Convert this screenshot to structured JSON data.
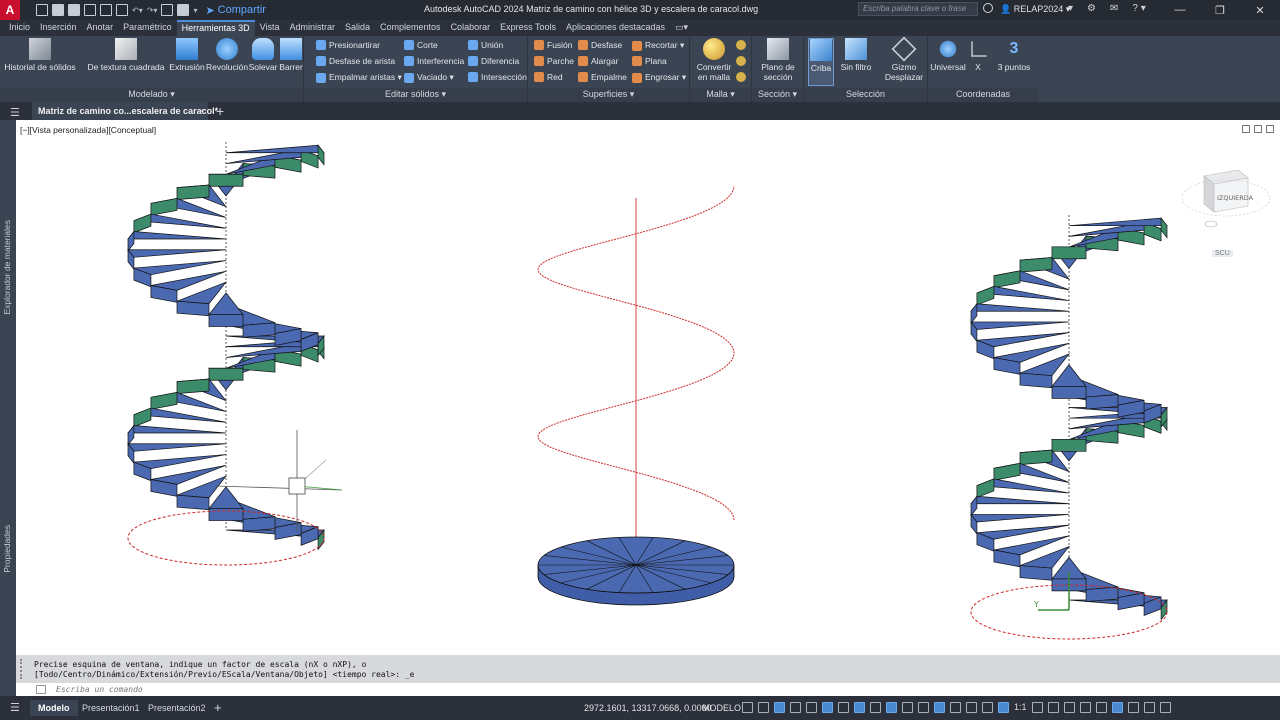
{
  "app": {
    "logo": "A",
    "title": "Autodesk AutoCAD 2024   Matriz de camino con hélice 3D y escalera de caracol.dwg",
    "share": "Compartir",
    "search_placeholder": "Escriba palabra clave o frase",
    "user": "RELAP2024"
  },
  "tabs": [
    "Inicio",
    "Inserción",
    "Anotar",
    "Paramétrico",
    "Herramientas 3D",
    "Vista",
    "Administrar",
    "Salida",
    "Complementos",
    "Colaborar",
    "Express Tools",
    "Aplicaciones destacadas"
  ],
  "active_tab": "Herramientas 3D",
  "ribbon": {
    "modelado": {
      "label": "Modelado ▾",
      "historial": "Historial de sólidos",
      "textura": "De textura cuadrada",
      "extrusion": "Extrusión",
      "revolucion": "Revolución",
      "solevar": "Solevar",
      "barrer": "Barrer"
    },
    "editar": {
      "label": "Editar sólidos ▾",
      "items": [
        "Presionartirar",
        "Desfase de arista",
        "Empalmar aristas ▾",
        "Corte",
        "Interferencia",
        "Vaciado ▾",
        "Unión",
        "Diferencia",
        "Intersección"
      ]
    },
    "superficies": {
      "label": "Superficies ▾",
      "items": [
        "Fusión",
        "Parche",
        "Red",
        "Desfase",
        "Alargar",
        "Empalme",
        "Recortar ▾",
        "Plana",
        "Engrosar ▾"
      ]
    },
    "malla": {
      "label": "Malla ▾",
      "convertir": "Convertir en malla"
    },
    "seccion": {
      "label": "Sección ▾",
      "plano": "Plano de sección"
    },
    "seleccion": {
      "label": "Selección",
      "criba": "Criba",
      "sinfiltro": "Sin filtro",
      "gizmo": "Gizmo Desplazar"
    },
    "coordenadas": {
      "label": "Coordenadas",
      "universal": "Universal",
      "x": "X",
      "tres": "3 puntos"
    }
  },
  "filetab": {
    "name": "Matriz de camino co...escalera de caracol*",
    "close": "×",
    "plus": "+"
  },
  "palettes": {
    "materiales": "Explorador de materiales",
    "propiedades": "Propiedades"
  },
  "viewport": {
    "label": "[−][Vista personalizada][Conceptual]",
    "viewcube": "IZQUIERDA",
    "ucs": "SCU"
  },
  "command": {
    "line1": "Precise esquina de ventana, indique un factor de escala (nX o nXP), o",
    "line2": "[Todo/Centro/Dinámico/Extensión/Previo/EScala/Ventana/Objeto] <tiempo real>: _e",
    "placeholder": "Escriba un comando"
  },
  "status": {
    "tabs": [
      "Modelo",
      "Presentación1",
      "Presentación2"
    ],
    "plus": "+",
    "coords": "2972.1601, 13317.0668, 0.0000",
    "space": "MODELO",
    "scale": "1:1"
  },
  "colors": {
    "step_blue": "#4a69b1",
    "step_green": "#3c8c6c",
    "helix_red": "#cc2020",
    "ribbon_bg": "#3b4453"
  }
}
